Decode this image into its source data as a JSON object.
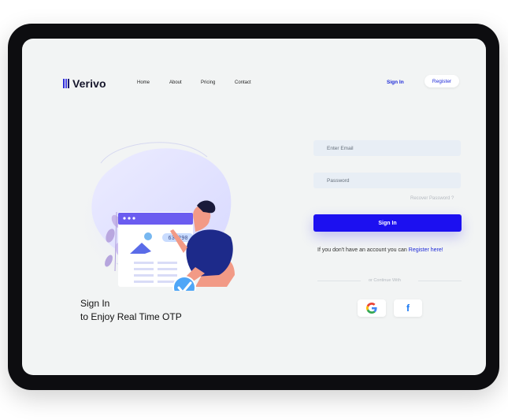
{
  "brand": {
    "name": "Verivo"
  },
  "nav": {
    "items": [
      "Home",
      "About",
      "Pricing",
      "Contact"
    ],
    "signin_label": "Sign In",
    "register_label": "Register"
  },
  "form": {
    "email_placeholder": "Enter Email",
    "password_placeholder": "Password",
    "recover_label": "Recover Password ?",
    "signin_button": "Sign In",
    "no_account_text": "If you don't have an account you can",
    "register_link": "Register here!",
    "continue_with": "or Continue With"
  },
  "hero": {
    "line1": "Sign In",
    "line2": "to Enjoy Real Time OTP",
    "otp_code": "638290"
  },
  "icons": {
    "google": "google-icon",
    "facebook": "facebook-icon",
    "check": "check-icon"
  },
  "colors": {
    "accent": "#1c10f0",
    "link": "#1e2ad8",
    "brand_dark": "#15152a"
  }
}
